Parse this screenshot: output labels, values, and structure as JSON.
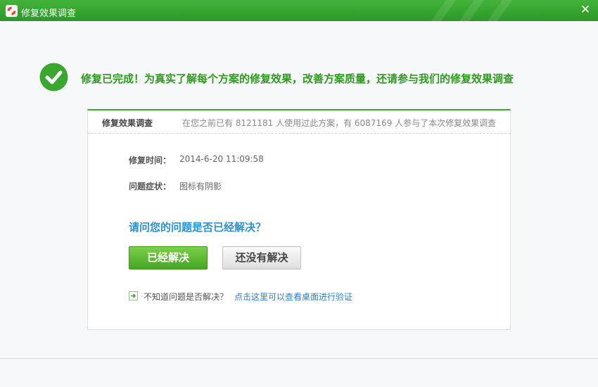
{
  "window": {
    "title": "修复效果调查",
    "close_icon": "close-icon",
    "logo_icon": "lifebuoy-icon",
    "accent_color": "#2f9a1f"
  },
  "banner": {
    "icon": "checkmark-circle-icon",
    "headline": "修复已完成！为真实了解每个方案的修复效果，改善方案质量，还请参与我们的修复效果调查"
  },
  "survey": {
    "title": "修复效果调查",
    "stats": "在您之前已有 8121181 人使用过此方案，有 6087169 人参与了本次修复效果调查",
    "repair_time_label": "修复时间：",
    "repair_time_value": "2014-6-20 11:09:58",
    "symptom_label": "问题症状：",
    "symptom_value": "图标有阴影",
    "question": "请问您的问题是否已经解决？",
    "yes_button": "已经解决",
    "no_button": "还没有解决",
    "hint_icon": "arrow-right-box-icon",
    "hint_text": "不知道问题是否解决？",
    "hint_link": "点击这里可以查看桌面进行验证"
  }
}
